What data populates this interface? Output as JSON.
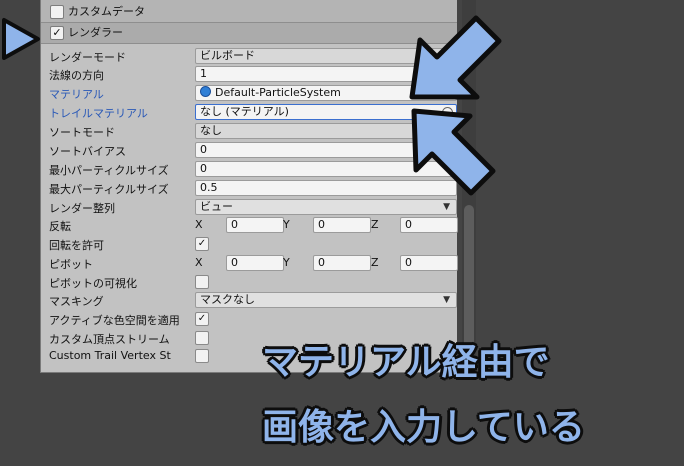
{
  "sections": {
    "custom_data": {
      "label": "カスタムデータ",
      "checked": false
    },
    "renderer": {
      "label": "レンダラー",
      "checked": true,
      "check_glyph": "✓"
    }
  },
  "rows": {
    "render_mode": {
      "label": "レンダーモード",
      "value": "ビルボード"
    },
    "normal_direction": {
      "label": "法線の方向",
      "value": "1"
    },
    "material": {
      "label": "マテリアル",
      "value": "Default-ParticleSystem"
    },
    "trail_material": {
      "label": "トレイルマテリアル",
      "value": "なし (マテリアル)"
    },
    "sort_mode": {
      "label": "ソートモード",
      "value": "なし"
    },
    "sorting_fudge": {
      "label": "ソートバイアス",
      "value": "0"
    },
    "min_particle_size": {
      "label": "最小パーティクルサイズ",
      "value": "0"
    },
    "max_particle_size": {
      "label": "最大パーティクルサイズ",
      "value": "0.5"
    },
    "render_alignment": {
      "label": "レンダー整列",
      "value": "ビュー"
    },
    "flip": {
      "label": "反転",
      "x_label": "X",
      "x": "0",
      "y_label": "Y",
      "y": "0",
      "z_label": "Z",
      "z": "0"
    },
    "allow_roll": {
      "label": "回転を許可",
      "checked": true
    },
    "pivot": {
      "label": "ピボット",
      "x_label": "X",
      "x": "0",
      "y_label": "Y",
      "y": "0",
      "z_label": "Z",
      "z": "0"
    },
    "visualize_pivot": {
      "label": "ピボットの可視化",
      "checked": false
    },
    "masking": {
      "label": "マスキング",
      "value": "マスクなし"
    },
    "apply_active_color_space": {
      "label": "アクティブな色空間を適用",
      "checked": true
    },
    "custom_vertex_streams": {
      "label": "カスタム頂点ストリーム",
      "checked": false
    },
    "custom_trail_vertex_streams": {
      "label": "Custom Trail Vertex St",
      "checked": false
    }
  },
  "glyphs": {
    "check": "✓",
    "dropdown": "▼"
  },
  "caption": {
    "line1": "マテリアル経由で",
    "line2": "画像を入力している"
  },
  "colors": {
    "arrow_fill": "#8fb4ea",
    "arrow_stroke": "#0d0d0d",
    "link_label": "#2a59b7",
    "caption_fill": "#8fb4ea"
  }
}
